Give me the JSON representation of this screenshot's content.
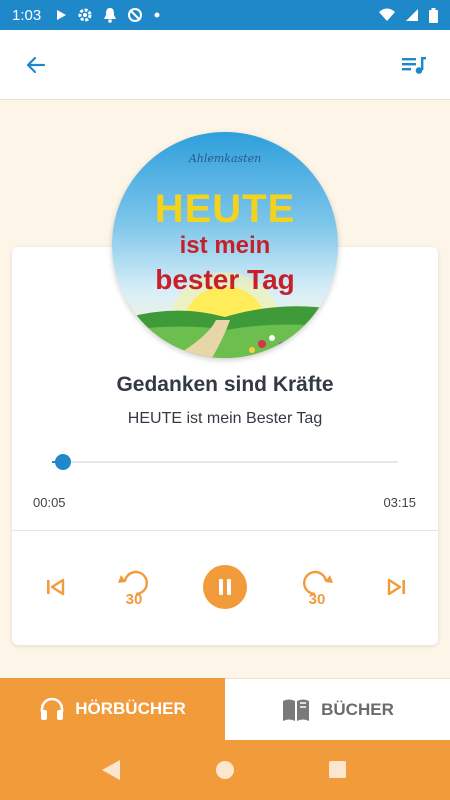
{
  "status_bar": {
    "time": "1:03",
    "icons_left": [
      "play-icon",
      "gear-icon",
      "bell-icon",
      "no-sync-icon",
      "dot-icon"
    ],
    "icons_right": [
      "wifi-icon",
      "signal-icon",
      "battery-icon"
    ]
  },
  "app_bar": {
    "back_icon": "back-arrow-icon",
    "queue_icon": "playlist-icon"
  },
  "cover": {
    "signature": "Ahlemkasten",
    "line1": "HEUTE",
    "line2": "ist mein",
    "line3": "bester Tag"
  },
  "player": {
    "track_title": "Gedanken sind Kräfte",
    "album": "HEUTE ist mein Bester Tag",
    "current_time": "00:05",
    "duration": "03:15",
    "progress": 0.026,
    "controls": {
      "prev_icon": "skip-previous-icon",
      "rewind_label": "30",
      "pause_icon": "pause-icon",
      "forward_label": "30",
      "next_icon": "skip-next-icon"
    }
  },
  "bottom_nav": {
    "tabs": [
      {
        "label": "HÖRBÜCHER",
        "icon": "headphones-icon",
        "active": true
      },
      {
        "label": "BÜCHER",
        "icon": "book-icon",
        "active": false
      }
    ]
  },
  "colors": {
    "primary_blue": "#1f88c9",
    "accent_orange": "#f29b3b",
    "background": "#fdf6e8"
  }
}
